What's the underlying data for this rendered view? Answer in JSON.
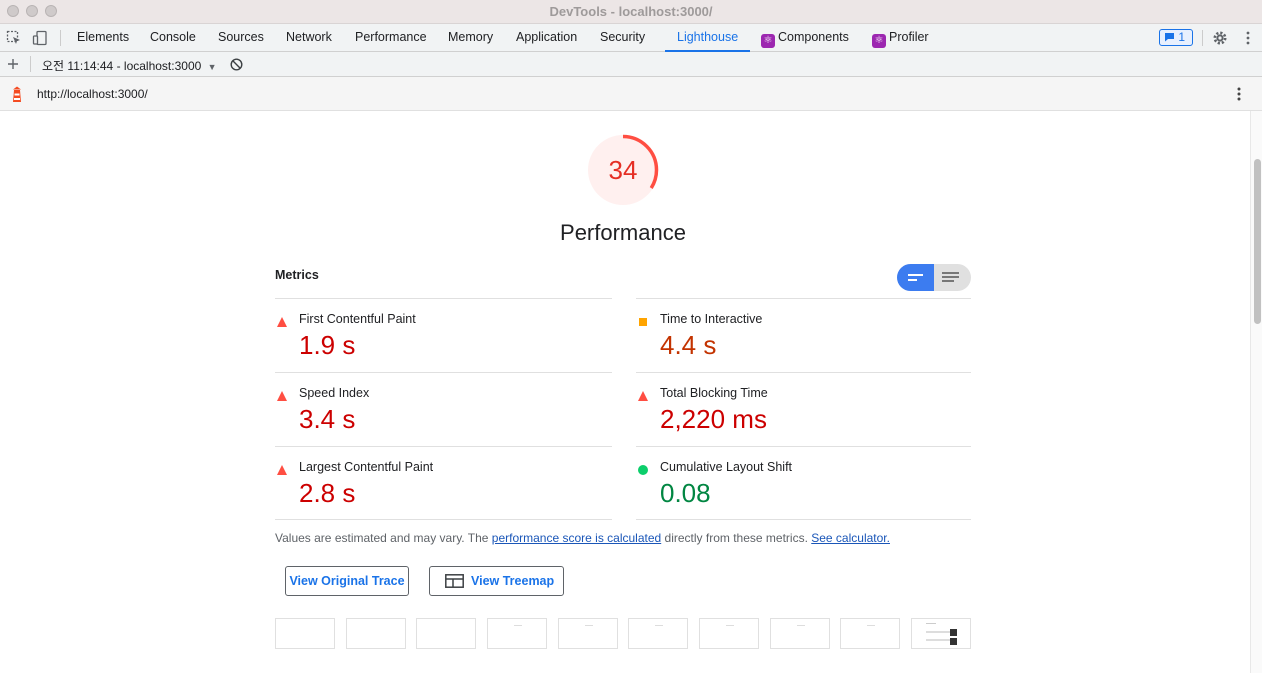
{
  "window": {
    "title": "DevTools - localhost:3000/"
  },
  "tabs": [
    {
      "label": "Elements"
    },
    {
      "label": "Console"
    },
    {
      "label": "Sources"
    },
    {
      "label": "Network"
    },
    {
      "label": "Performance"
    },
    {
      "label": "Memory"
    },
    {
      "label": "Application"
    },
    {
      "label": "Security"
    },
    {
      "label": "Lighthouse",
      "active": true
    },
    {
      "label": "Components"
    },
    {
      "label": "Profiler"
    }
  ],
  "issues_badge": "1",
  "report_bar": {
    "report_selector": "오전 11:14:44 - localhost:3000"
  },
  "url_bar": {
    "url": "http://localhost:3000/"
  },
  "report": {
    "score": "34",
    "score_fraction": 0.34,
    "category": "Performance",
    "metrics_heading": "Metrics",
    "metrics": [
      {
        "label": "First Contentful Paint",
        "value": "1.9 s",
        "rating": "fail"
      },
      {
        "label": "Time to Interactive",
        "value": "4.4 s",
        "rating": "average"
      },
      {
        "label": "Speed Index",
        "value": "3.4 s",
        "rating": "fail"
      },
      {
        "label": "Total Blocking Time",
        "value": "2,220 ms",
        "rating": "fail"
      },
      {
        "label": "Largest Contentful Paint",
        "value": "2.8 s",
        "rating": "fail"
      },
      {
        "label": "Cumulative Layout Shift",
        "value": "0.08",
        "rating": "pass"
      }
    ],
    "note": {
      "prefix": "Values are estimated and may vary. The ",
      "link1": "performance score is calculated",
      "middle": " directly from these metrics. ",
      "link2": "See calculator."
    },
    "buttons": {
      "view_trace": "View Original Trace",
      "view_treemap": "View Treemap"
    }
  },
  "colors": {
    "fail": "#cc0000",
    "average": "#c33300",
    "pass": "#018642",
    "accent": "#1a73e8"
  }
}
